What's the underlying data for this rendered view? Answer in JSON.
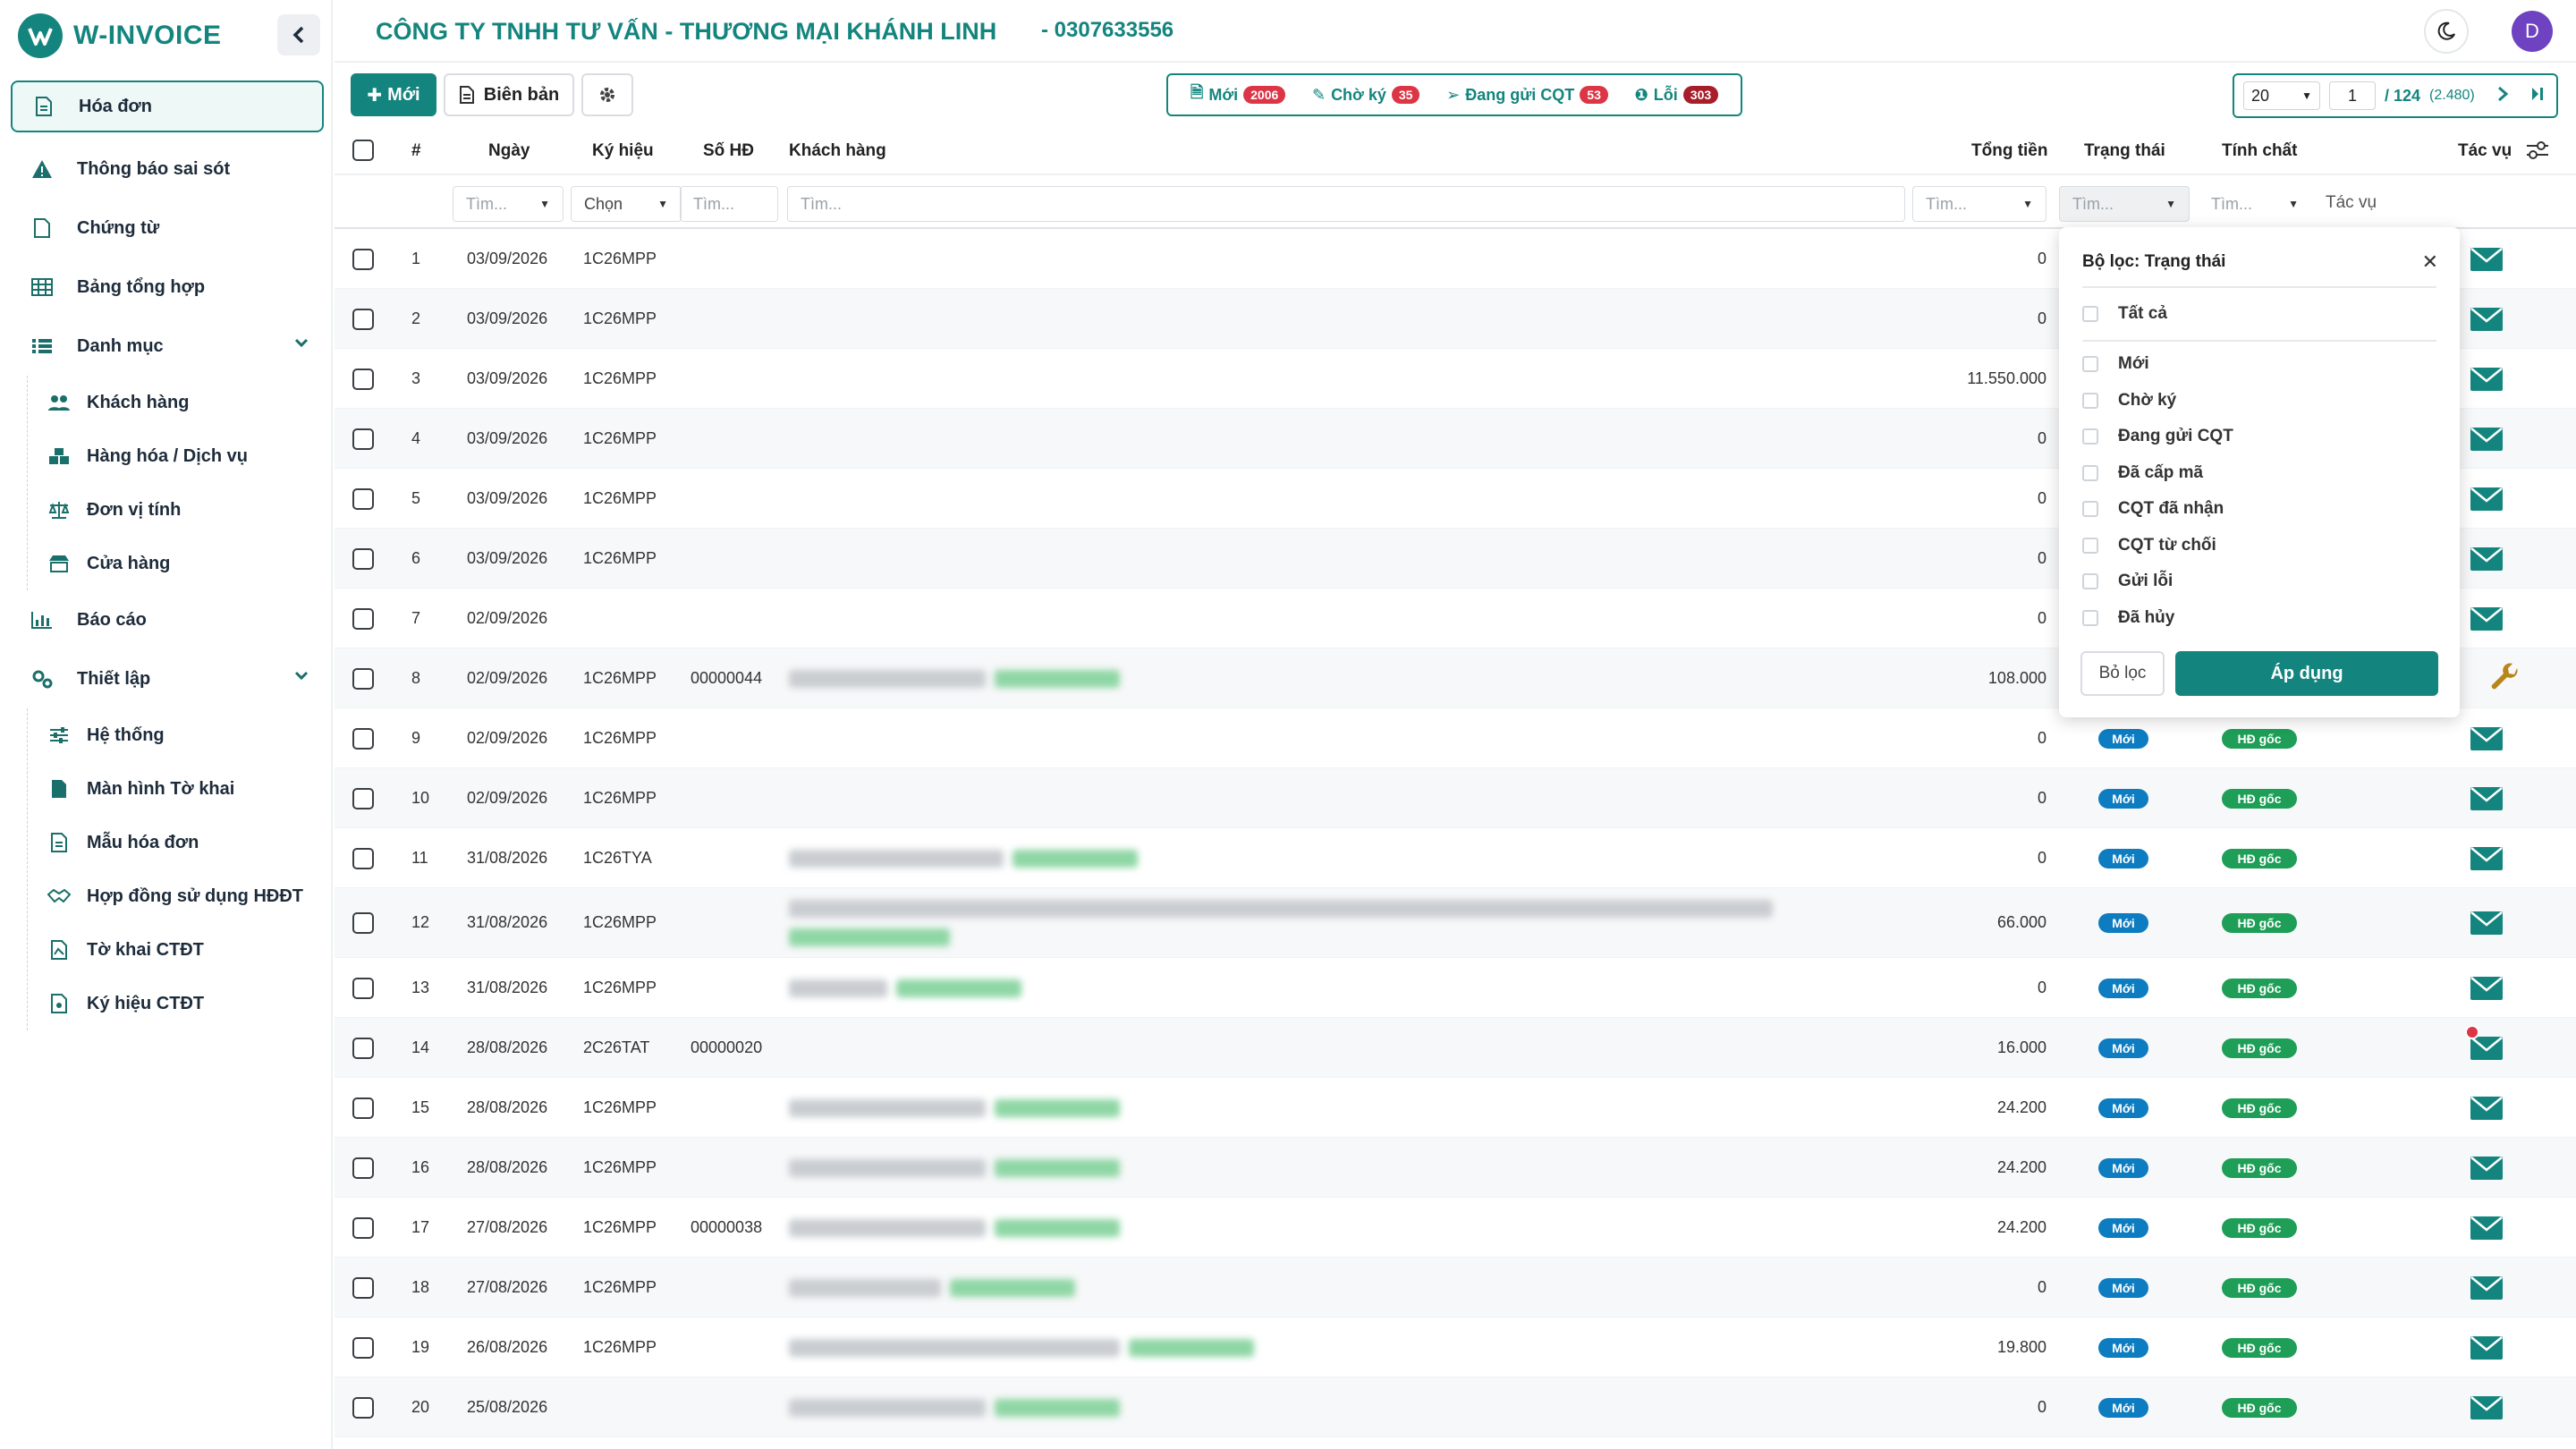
{
  "brand": {
    "name": "W-INVOICE"
  },
  "sidebar": {
    "items": [
      {
        "label": "Hóa đơn",
        "icon": "file-icon",
        "active": true
      },
      {
        "label": "Thông báo sai sót",
        "icon": "warning-icon"
      },
      {
        "label": "Chứng từ",
        "icon": "document-icon"
      },
      {
        "label": "Bảng tổng hợp",
        "icon": "table-icon"
      },
      {
        "label": "Danh mục",
        "icon": "list-icon",
        "expandable": true,
        "children": [
          {
            "label": "Khách hàng",
            "icon": "users-icon"
          },
          {
            "label": "Hàng hóa / Dịch vụ",
            "icon": "boxes-icon"
          },
          {
            "label": "Đơn vị tính",
            "icon": "scale-icon"
          },
          {
            "label": "Cửa hàng",
            "icon": "store-icon"
          }
        ]
      },
      {
        "label": "Báo cáo",
        "icon": "chart-icon"
      },
      {
        "label": "Thiết lập",
        "icon": "settings-icon",
        "expandable": true,
        "children": [
          {
            "label": "Hệ thống",
            "icon": "sliders-icon"
          },
          {
            "label": "Màn hình Tờ khai",
            "icon": "form-icon"
          },
          {
            "label": "Mẫu hóa đơn",
            "icon": "template-icon"
          },
          {
            "label": "Hợp đồng sử dụng HĐĐT",
            "icon": "handshake-icon"
          },
          {
            "label": "Tờ khai CTĐT",
            "icon": "declaration-icon"
          },
          {
            "label": "Ký hiệu CTĐT",
            "icon": "symbol-icon"
          }
        ]
      }
    ]
  },
  "header": {
    "company": "CÔNG TY TNHH TƯ VẤN - THƯƠNG MẠI KHÁNH LINH",
    "tax_code": "- 0307633556",
    "avatar_letter": "D"
  },
  "toolbar": {
    "new_label": "Mới",
    "report_label": "Biên bản",
    "status_tabs": [
      {
        "label": "Mới",
        "count": "2006",
        "icon": "file-icon"
      },
      {
        "label": "Chờ ký",
        "count": "35",
        "icon": "sign-icon"
      },
      {
        "label": "Đang gửi CQT",
        "count": "53",
        "icon": "send-icon"
      },
      {
        "label": "Lỗi",
        "count": "303",
        "icon": "error-icon"
      }
    ],
    "pager": {
      "page_size": "20",
      "page": "1",
      "total_pages": "/ 124",
      "total_records": "(2.480)"
    }
  },
  "table": {
    "headers": {
      "index": "#",
      "date": "Ngày",
      "symbol": "Ký hiệu",
      "number": "Số HĐ",
      "customer": "Khách hàng",
      "total": "Tổng tiền",
      "status": "Trạng thái",
      "nature": "Tính chất",
      "actions": "Tác vụ"
    },
    "filters": {
      "date": "Tìm...",
      "symbol": "Chọn",
      "number": "Tìm...",
      "customer": "Tìm...",
      "total": "Tìm...",
      "status": "Tìm...",
      "nature": "Tìm...",
      "actions": "Tác vụ"
    },
    "rows": [
      {
        "idx": "1",
        "date": "03/09/2026",
        "symbol": "1C26MPP",
        "number": "",
        "total": "0"
      },
      {
        "idx": "2",
        "date": "03/09/2026",
        "symbol": "1C26MPP",
        "number": "",
        "total": "0"
      },
      {
        "idx": "3",
        "date": "03/09/2026",
        "symbol": "1C26MPP",
        "number": "",
        "total": "11.550.000"
      },
      {
        "idx": "4",
        "date": "03/09/2026",
        "symbol": "1C26MPP",
        "number": "",
        "total": "0"
      },
      {
        "idx": "5",
        "date": "03/09/2026",
        "symbol": "1C26MPP",
        "number": "",
        "total": "0"
      },
      {
        "idx": "6",
        "date": "03/09/2026",
        "symbol": "1C26MPP",
        "number": "",
        "total": "0"
      },
      {
        "idx": "7",
        "date": "02/09/2026",
        "symbol": "",
        "number": "",
        "total": "0"
      },
      {
        "idx": "8",
        "date": "02/09/2026",
        "symbol": "1C26MPP",
        "number": "00000044",
        "total": "108.000"
      },
      {
        "idx": "9",
        "date": "02/09/2026",
        "symbol": "1C26MPP",
        "number": "",
        "total": "0",
        "status": "Mới",
        "nature": "HĐ gốc"
      },
      {
        "idx": "10",
        "date": "02/09/2026",
        "symbol": "1C26MPP",
        "number": "",
        "total": "0",
        "status": "Mới",
        "nature": "HĐ gốc"
      },
      {
        "idx": "11",
        "date": "31/08/2026",
        "symbol": "1C26TYA",
        "number": "",
        "total": "0",
        "status": "Mới",
        "nature": "HĐ gốc"
      },
      {
        "idx": "12",
        "date": "31/08/2026",
        "symbol": "1C26MPP",
        "number": "",
        "total": "66.000",
        "status": "Mới",
        "nature": "HĐ gốc"
      },
      {
        "idx": "13",
        "date": "31/08/2026",
        "symbol": "1C26MPP",
        "number": "",
        "total": "0",
        "status": "Mới",
        "nature": "HĐ gốc"
      },
      {
        "idx": "14",
        "date": "28/08/2026",
        "symbol": "2C26TAT",
        "number": "00000020",
        "total": "16.000",
        "status": "Mới",
        "nature": "HĐ gốc"
      },
      {
        "idx": "15",
        "date": "28/08/2026",
        "symbol": "1C26MPP",
        "number": "",
        "total": "24.200",
        "status": "Mới",
        "nature": "HĐ gốc"
      },
      {
        "idx": "16",
        "date": "28/08/2026",
        "symbol": "1C26MPP",
        "number": "",
        "total": "24.200",
        "status": "Mới",
        "nature": "HĐ gốc"
      },
      {
        "idx": "17",
        "date": "27/08/2026",
        "symbol": "1C26MPP",
        "number": "00000038",
        "total": "24.200",
        "status": "Mới",
        "nature": "HĐ gốc"
      },
      {
        "idx": "18",
        "date": "27/08/2026",
        "symbol": "1C26MPP",
        "number": "",
        "total": "0",
        "status": "Mới",
        "nature": "HĐ gốc"
      },
      {
        "idx": "19",
        "date": "26/08/2026",
        "symbol": "1C26MPP",
        "number": "",
        "total": "19.800",
        "status": "Mới",
        "nature": "HĐ gốc"
      },
      {
        "idx": "20",
        "date": "25/08/2026",
        "symbol": "",
        "number": "",
        "total": "0",
        "status": "Mới",
        "nature": "HĐ gốc"
      }
    ]
  },
  "filter_popup": {
    "title": "Bộ lọc: Trạng thái",
    "all_label": "Tất cả",
    "options": [
      "Mới",
      "Chờ ký",
      "Đang gửi CQT",
      "Đã cấp mã",
      "CQT đã nhận",
      "CQT từ chối",
      "Gửi lỗi",
      "Đã hủy"
    ],
    "clear_label": "Bỏ lọc",
    "apply_label": "Áp dụng"
  }
}
